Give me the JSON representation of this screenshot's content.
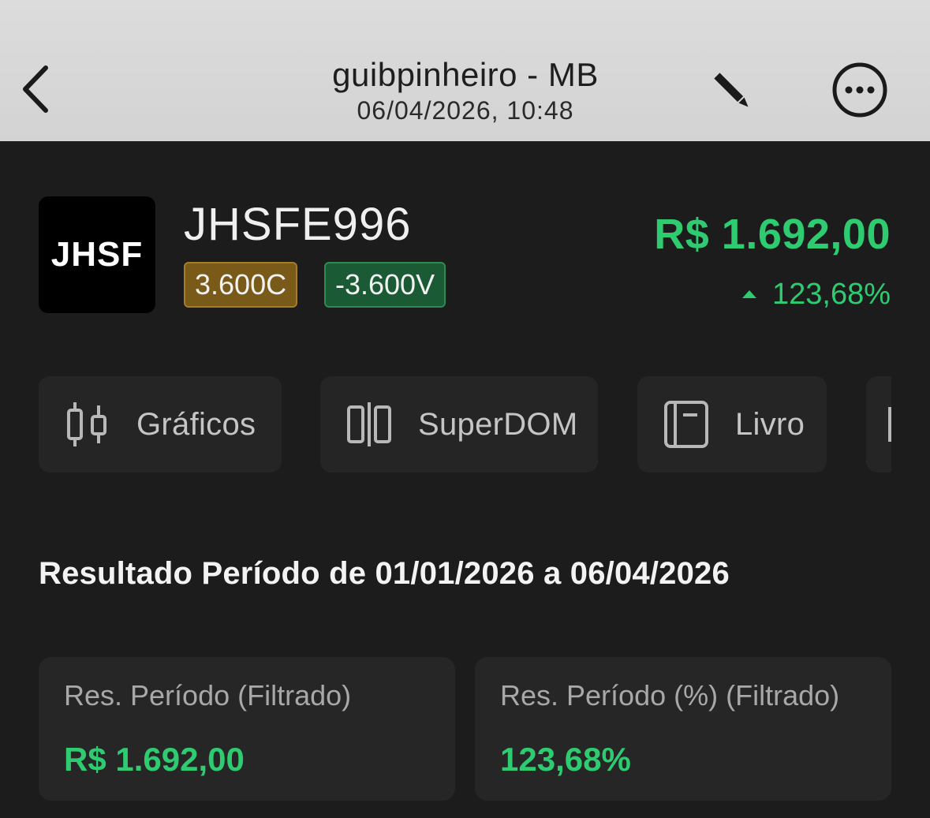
{
  "header": {
    "title": "guibpinheiro - MB",
    "subtitle": "06/04/2026, 10:48",
    "icons": {
      "back": "chevron-left-icon",
      "edit": "pencil-icon",
      "more": "more-horizontal-circle-icon"
    }
  },
  "asset": {
    "logo_text": "JHSF",
    "ticker": "JHSFE996",
    "buy_badge": "3.600C",
    "sell_badge": "-3.600V",
    "price": "R$ 1.692,00",
    "change": "123,68%",
    "change_direction": "up"
  },
  "tabs": [
    {
      "label": "Gráficos",
      "icon": "candlestick-icon"
    },
    {
      "label": "SuperDOM",
      "icon": "columns-icon"
    },
    {
      "label": "Livro",
      "icon": "book-icon"
    },
    {
      "label": "",
      "icon": "partially-visible-tab-icon"
    }
  ],
  "result": {
    "title": "Resultado Período de 01/01/2026 a 06/04/2026",
    "cards": [
      {
        "label": "Res. Período (Filtrado)",
        "value": "R$ 1.692,00"
      },
      {
        "label": "Res. Período (%) (Filtrado)",
        "value": "123,68%"
      }
    ]
  },
  "colors": {
    "positive": "#2ecb71",
    "buy_badge_bg": "#7a5a18",
    "sell_badge_bg": "#1a5a34",
    "background": "#1c1c1c",
    "header_bg": "#d6d6d6"
  }
}
